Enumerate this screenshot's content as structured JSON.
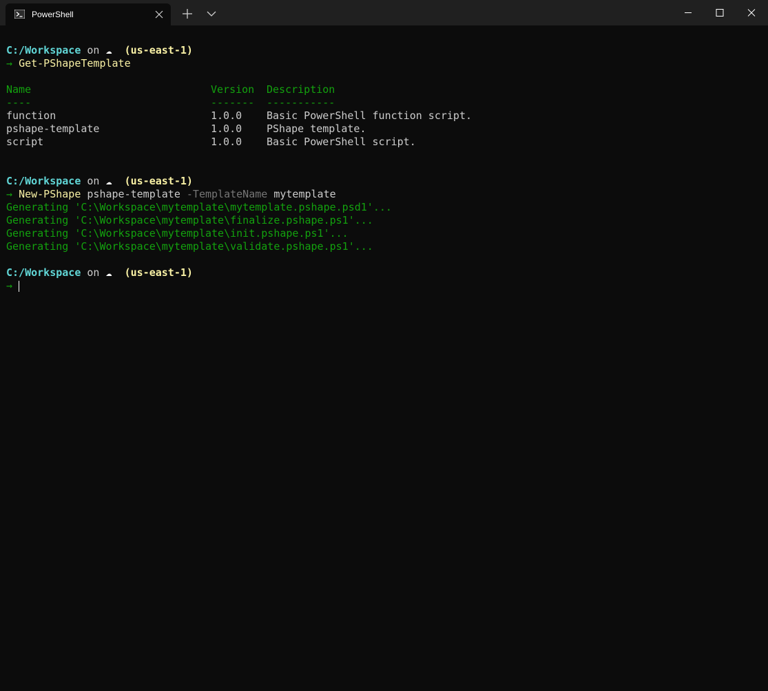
{
  "window": {
    "tab_title": "PowerShell",
    "icons": {
      "tab": "powershell-icon",
      "close_tab": "close-icon",
      "new_tab": "plus-icon",
      "dropdown": "chevron-down-icon",
      "minimize": "minimize-icon",
      "maximize": "maximize-icon",
      "close": "close-icon"
    }
  },
  "colors": {
    "background": "#0c0c0c",
    "titlebar": "#202020",
    "path": "#61d6d6",
    "command": "#f9f1a5",
    "arrow": "#13a10e",
    "output": "#cccccc",
    "param": "#767676"
  },
  "prompt": {
    "path": "C:/Workspace",
    "on": "on",
    "cloud_icon": "cloud-icon",
    "region": "(us-east-1)",
    "arrow": "→"
  },
  "block1": {
    "command": "Get-PShapeTemplate",
    "table": {
      "headers": [
        "Name",
        "Version",
        "Description"
      ],
      "separators": [
        "----",
        "-------",
        "-----------"
      ],
      "rows": [
        [
          "function",
          "1.0.0",
          "Basic PowerShell function script."
        ],
        [
          "pshape-template",
          "1.0.0",
          "PShape template."
        ],
        [
          "script",
          "1.0.0",
          "Basic PowerShell script."
        ]
      ]
    }
  },
  "block2": {
    "command": "New-PShape",
    "arg": "pshape-template",
    "param": "-TemplateName",
    "param_value": "mytemplate",
    "output": [
      "Generating 'C:\\Workspace\\mytemplate\\mytemplate.pshape.psd1'...",
      "Generating 'C:\\Workspace\\mytemplate\\finalize.pshape.ps1'...",
      "Generating 'C:\\Workspace\\mytemplate\\init.pshape.ps1'...",
      "Generating 'C:\\Workspace\\mytemplate\\validate.pshape.ps1'..."
    ]
  }
}
